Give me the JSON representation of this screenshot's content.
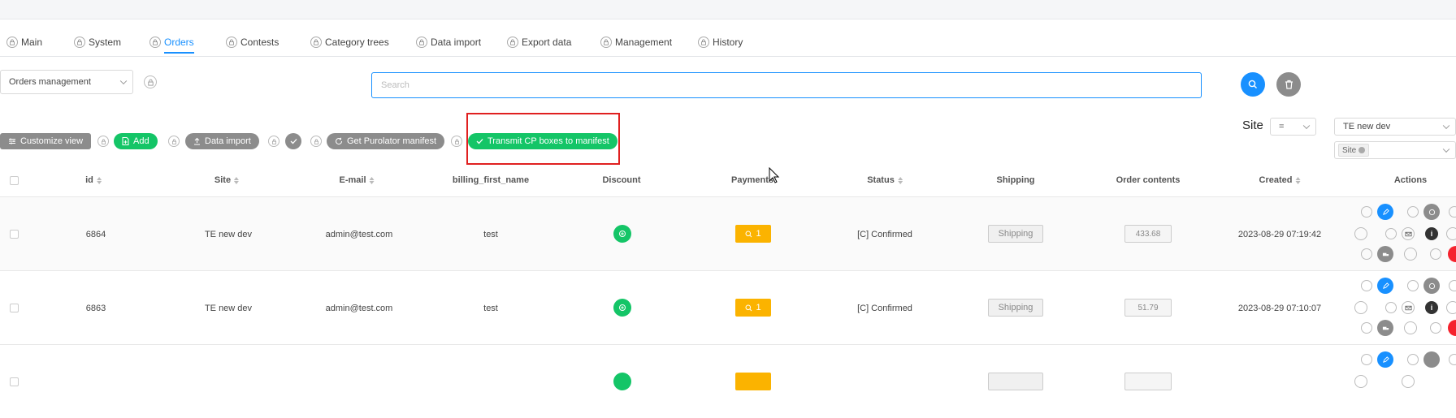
{
  "tabs": [
    {
      "label": "Main"
    },
    {
      "label": "System"
    },
    {
      "label": "Orders",
      "active": true
    },
    {
      "label": "Contests"
    },
    {
      "label": "Category trees"
    },
    {
      "label": "Data import"
    },
    {
      "label": "Export data"
    },
    {
      "label": "Management"
    },
    {
      "label": "History"
    }
  ],
  "view_select": {
    "value": "Orders management"
  },
  "search": {
    "placeholder": "Search"
  },
  "toolbar": {
    "customize_view": "Customize view",
    "add": "Add",
    "data_import": "Data import",
    "get_purolator": "Get Purolator manifest",
    "transmit_cp": "Transmit CP boxes to manifest"
  },
  "filter": {
    "label": "Site",
    "operator": "=",
    "value": "TE new dev",
    "tag": "Site"
  },
  "table": {
    "columns": [
      "id",
      "Site",
      "E-mail",
      "billing_first_name",
      "Discount",
      "Payments",
      "Status",
      "Shipping",
      "Order contents",
      "Created",
      "Actions"
    ],
    "rows": [
      {
        "id": "6864",
        "site": "TE new dev",
        "email": "admin@test.com",
        "first_name": "test",
        "payments": "1",
        "status": "[C] Confirmed",
        "shipping": "Shipping",
        "contents": "433.68",
        "created": "2023-08-29 07:19:42"
      },
      {
        "id": "6863",
        "site": "TE new dev",
        "email": "admin@test.com",
        "first_name": "test",
        "payments": "1",
        "status": "[C] Confirmed",
        "shipping": "Shipping",
        "contents": "51.79",
        "created": "2023-08-29 07:10:07"
      },
      {
        "id": "",
        "site": "",
        "email": "",
        "first_name": "",
        "payments": "",
        "status": "",
        "shipping": "",
        "contents": "",
        "created": ""
      }
    ]
  },
  "colors": {
    "accent": "#1890ff",
    "green": "#14c567",
    "orange": "#fbb300",
    "gray": "#8c8c8c",
    "highlight": "#e02020"
  }
}
